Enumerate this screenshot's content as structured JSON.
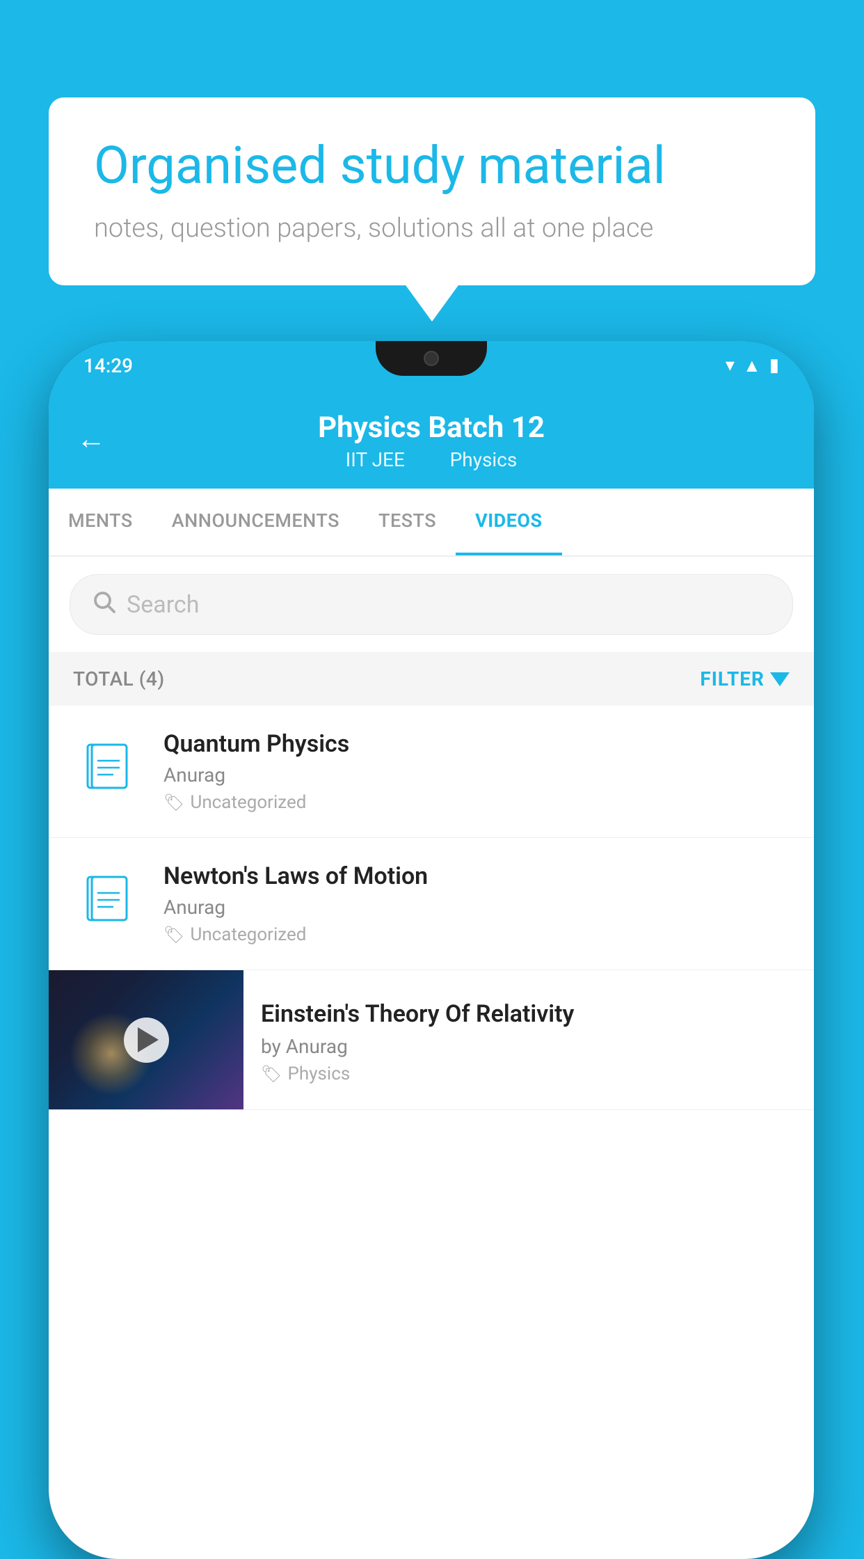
{
  "background_color": "#1BB8E8",
  "bubble": {
    "title": "Organised study material",
    "subtitle": "notes, question papers, solutions all at one place"
  },
  "phone": {
    "status_bar": {
      "time": "14:29",
      "icons": [
        "wifi",
        "signal",
        "battery"
      ]
    },
    "header": {
      "back_label": "←",
      "title": "Physics Batch 12",
      "subtitle_left": "IIT JEE",
      "subtitle_right": "Physics"
    },
    "tabs": [
      {
        "label": "MENTS",
        "active": false
      },
      {
        "label": "ANNOUNCEMENTS",
        "active": false
      },
      {
        "label": "TESTS",
        "active": false
      },
      {
        "label": "VIDEOS",
        "active": true
      }
    ],
    "search": {
      "placeholder": "Search"
    },
    "filter_bar": {
      "total_label": "TOTAL (4)",
      "filter_label": "FILTER"
    },
    "videos": [
      {
        "id": 1,
        "title": "Quantum Physics",
        "author": "Anurag",
        "tag": "Uncategorized",
        "type": "file"
      },
      {
        "id": 2,
        "title": "Newton's Laws of Motion",
        "author": "Anurag",
        "tag": "Uncategorized",
        "type": "file"
      },
      {
        "id": 3,
        "title": "Einstein's Theory Of Relativity",
        "author": "by Anurag",
        "tag": "Physics",
        "type": "video"
      }
    ]
  }
}
